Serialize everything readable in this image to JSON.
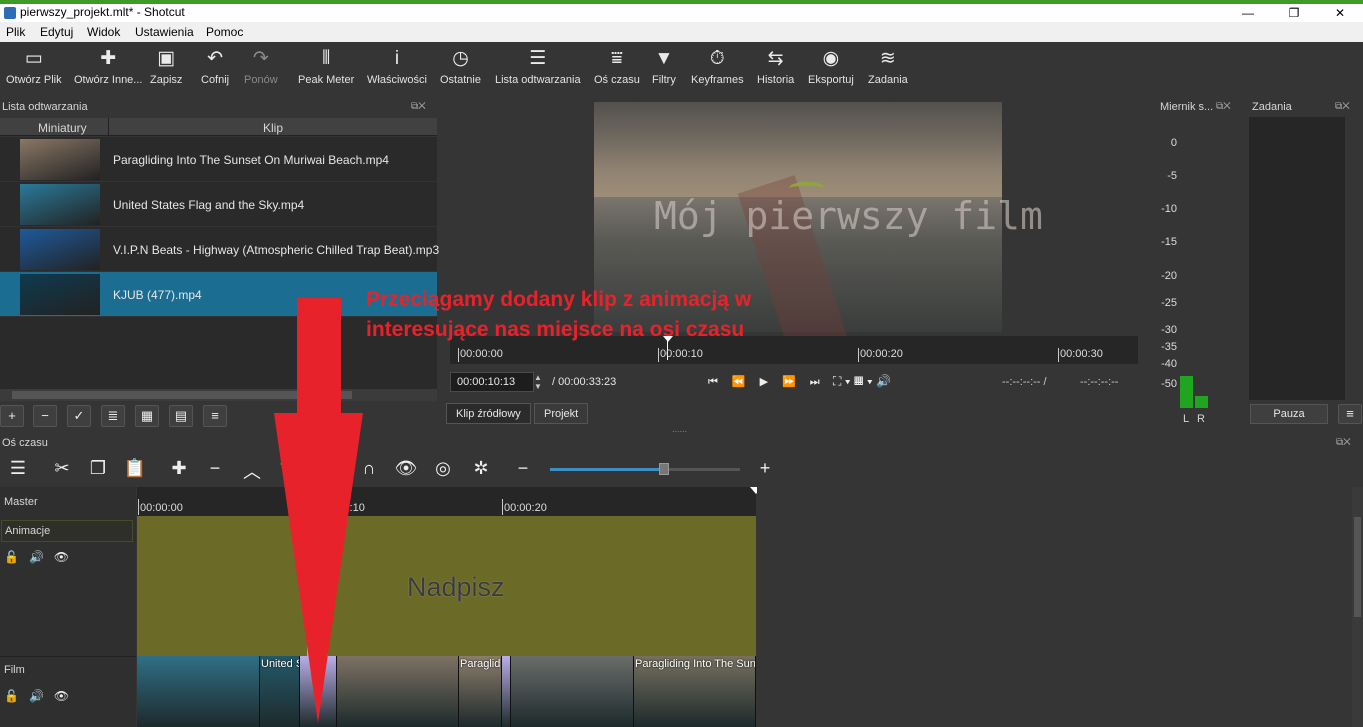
{
  "window": {
    "title": "pierwszy_projekt.mlt* - Shotcut",
    "minimize": "—",
    "maximize": "❐",
    "close": "✕"
  },
  "menu": [
    "Plik",
    "Edytuj",
    "Widok",
    "Ustawienia",
    "Pomoc"
  ],
  "toolbar": [
    {
      "label": "Otwórz Plik",
      "icon": "folder-open-icon",
      "glyph": "▭",
      "enabled": true
    },
    {
      "label": "Otwórz Inne...",
      "icon": "open-other-icon",
      "glyph": "✚",
      "enabled": true
    },
    {
      "label": "Zapisz",
      "icon": "save-icon",
      "glyph": "▣",
      "enabled": true
    },
    {
      "label": "Cofnij",
      "icon": "undo-icon",
      "glyph": "↶",
      "enabled": true
    },
    {
      "label": "Ponów",
      "icon": "redo-icon",
      "glyph": "↷",
      "enabled": false
    },
    {
      "label": "Peak Meter",
      "icon": "peak-meter-icon",
      "glyph": "⦀",
      "enabled": true
    },
    {
      "label": "Właściwości",
      "icon": "info-icon",
      "glyph": "i",
      "enabled": true
    },
    {
      "label": "Ostatnie",
      "icon": "clock-icon",
      "glyph": "◷",
      "enabled": true
    },
    {
      "label": "Lista odtwarzania",
      "icon": "list-icon",
      "glyph": "☰",
      "enabled": true
    },
    {
      "label": "Oś czasu",
      "icon": "timeline-icon",
      "glyph": "⩸",
      "enabled": true
    },
    {
      "label": "Filtry",
      "icon": "filter-icon",
      "glyph": "▼",
      "enabled": true
    },
    {
      "label": "Keyframes",
      "icon": "stopwatch-icon",
      "glyph": "⏱",
      "enabled": true
    },
    {
      "label": "Historia",
      "icon": "history-icon",
      "glyph": "⇆",
      "enabled": true
    },
    {
      "label": "Eksportuj",
      "icon": "disc-icon",
      "glyph": "◉",
      "enabled": true
    },
    {
      "label": "Zadania",
      "icon": "database-icon",
      "glyph": "≋",
      "enabled": true
    }
  ],
  "playlist": {
    "title": "Lista odtwarzania",
    "columns": [
      "Miniatury",
      "Klip"
    ],
    "items": [
      {
        "name": "Paragliding Into The Sunset On Muriwai Beach.mp4",
        "thumb": "#8a7766",
        "selected": false
      },
      {
        "name": "United States Flag and the Sky.mp4",
        "thumb": "#2a7a9a",
        "selected": false
      },
      {
        "name": "V.I.P.N Beats - Highway (Atmospheric Chilled Trap Beat).mp3",
        "thumb": "#1e5a9c",
        "selected": false
      },
      {
        "name": "KJUB (477).mp4",
        "thumb": "#0e3a4f",
        "selected": true
      }
    ],
    "buttons": [
      "+",
      "−",
      "✓",
      "≣",
      "▦",
      "▤",
      "≡"
    ]
  },
  "viewer": {
    "overlay_text": "Mój pierwszy film",
    "ruler": [
      "00:00:00",
      "00:00:10",
      "00:00:20",
      "00:00:30"
    ],
    "timecode": "00:00:10:13",
    "duration": "/ 00:00:33:23",
    "in_point": "--:--:--:-- /",
    "out_point": "--:--:--:--",
    "tabs": [
      "Klip źródłowy",
      "Projekt"
    ]
  },
  "meter": {
    "title": "Miernik s...",
    "scale": [
      "0",
      "-5",
      "-10",
      "-15",
      "-20",
      "-25",
      "-30",
      "-35",
      "-40",
      "-50"
    ],
    "channels": [
      "L",
      "R"
    ]
  },
  "jobs": {
    "title": "Zadania",
    "pause": "Pauza"
  },
  "timeline": {
    "title": "Oś czasu",
    "ruler": [
      "00:00:00",
      "00:00:10",
      "00:00:20"
    ],
    "zoom": 0.6,
    "tracks": [
      {
        "name": "Master"
      },
      {
        "name": "Animacje",
        "clip_label": "Nadpisz"
      },
      {
        "name": "Film"
      }
    ],
    "film_clips": [
      {
        "label": "",
        "color": "#2f6f86"
      },
      {
        "label": "United S",
        "color": "#24596a"
      },
      {
        "label": "",
        "color": "#b9aee8"
      },
      {
        "label": "",
        "color": "#7d7263"
      },
      {
        "label": "Paraglid",
        "color": "#8b7d6b"
      },
      {
        "label": "",
        "color": "#b9aee8"
      },
      {
        "label": "",
        "color": "#6a6d6a"
      },
      {
        "label": "Paragliding Into The Sun",
        "color": "#76715f"
      }
    ]
  },
  "annotation": "Przeciągamy dodany klip z animacją w interesujące nas miejsce na osi czasu"
}
